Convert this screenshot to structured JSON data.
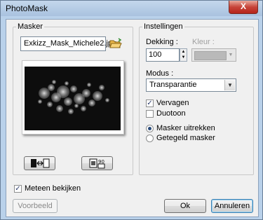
{
  "window": {
    "title": "PhotoMask",
    "close_glyph": "X"
  },
  "masker": {
    "group_label": "Masker",
    "filename": "Exkizz_Mask_Michele2.jpg",
    "open_icon": "folder-open-icon"
  },
  "bottom_buttons": {
    "invert_icon": "invert-mask-icon",
    "rotate_icon": "rotate-90-icon"
  },
  "settings": {
    "group_label": "Instellingen",
    "opacity_label": "Dekking :",
    "opacity_value": "100",
    "color_label": "Kleur :",
    "mode_label": "Modus :",
    "mode_value": "Transparantie",
    "blur_label": "Vervagen",
    "blur_checked": true,
    "duotone_label": "Duotoon",
    "duotone_checked": false,
    "radio_extract": "Masker uitrekken",
    "radio_tiled": "Getegeld masker",
    "selected_radio": "extract"
  },
  "preview_checkbox": {
    "label": "Meteen bekijken",
    "checked": true
  },
  "footer": {
    "preview_button": "Voorbeeld",
    "ok_button": "Ok",
    "cancel_button": "Annuleren"
  },
  "colors": {
    "accent_focus": "#3c7fb1",
    "titlebar": "#b9d1ea"
  }
}
